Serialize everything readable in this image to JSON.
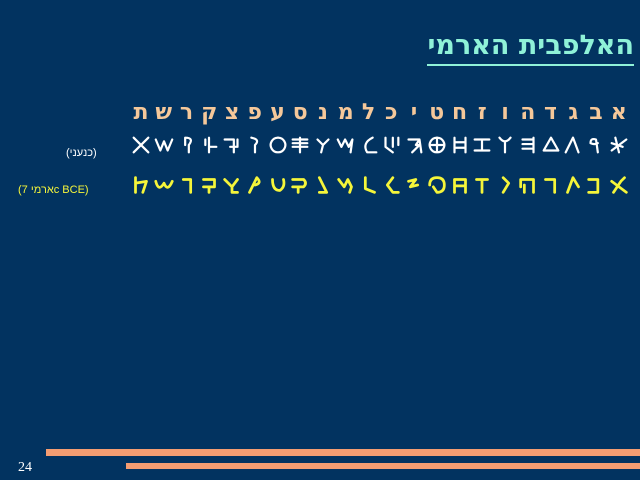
{
  "slide": {
    "title": "האלפבית הארמי",
    "page_number": "24"
  },
  "hebrew_row": {
    "letters": [
      "א",
      "ב",
      "ג",
      "ד",
      "ה",
      "ו",
      "ז",
      "ח",
      "ט",
      "י",
      "כ",
      "ל",
      "מ",
      "נ",
      "ס",
      "ע",
      "פ",
      "צ",
      "ק",
      "ר",
      "ש",
      "ת"
    ]
  },
  "canaanite_row": {
    "label": "(כנעני)",
    "color": "#ffffff",
    "glyph_names": [
      "aleph",
      "bet",
      "gimel",
      "dalet",
      "he",
      "vav",
      "zayin",
      "het",
      "tet",
      "yod",
      "kaf",
      "lamed",
      "mem",
      "nun",
      "samekh",
      "ayin",
      "pe",
      "tsadi",
      "qof",
      "resh",
      "shin",
      "tav"
    ]
  },
  "aramaic_row": {
    "label": "(ארמי 7c BCE)",
    "color": "#f5f53a",
    "glyph_names": [
      "aleph",
      "bet",
      "gimel",
      "dalet",
      "he",
      "vav",
      "zayin",
      "het",
      "tet",
      "yod",
      "kaf",
      "lamed",
      "mem",
      "nun",
      "samekh",
      "ayin",
      "pe",
      "tsadi",
      "qof",
      "resh",
      "shin",
      "tav"
    ]
  },
  "colors": {
    "background": "#023360",
    "title": "#8ff2d8",
    "hebrew_letters": "#f5c89a",
    "decorative_bars": "#f49d72"
  }
}
